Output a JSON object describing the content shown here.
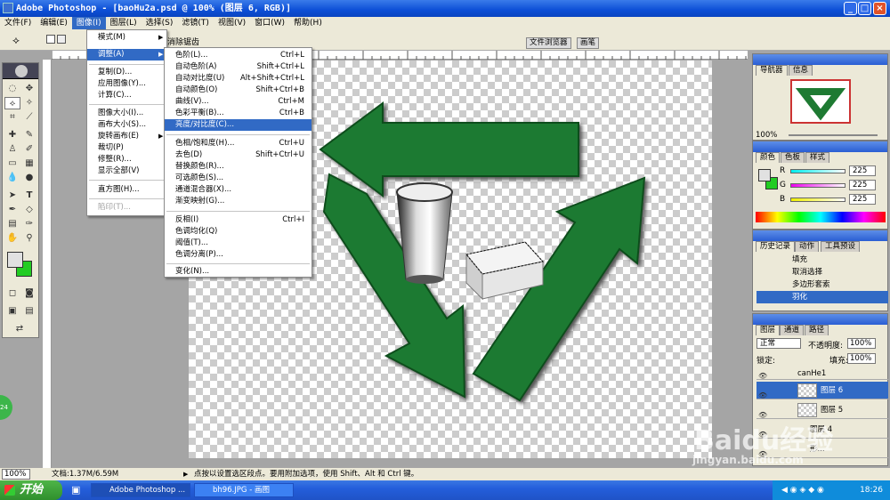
{
  "window": {
    "title": "Adobe Photoshop - [baoHu2a.psd @ 100% (图层 6, RGB)]"
  },
  "menubar": {
    "items": [
      "文件(F)",
      "编辑(E)",
      "图像(I)",
      "图层(L)",
      "选择(S)",
      "滤镜(T)",
      "视图(V)",
      "窗口(W)",
      "帮助(H)"
    ]
  },
  "optionbar": {
    "clear_label": "消除锯齿"
  },
  "tabs": {
    "file_browser": "文件浏览器",
    "brushes": "画笔"
  },
  "image_menu": {
    "items": [
      "模式(M)",
      "调整(A)",
      "复制(D)...",
      "应用图像(Y)...",
      "计算(C)...",
      "图像大小(I)...",
      "画布大小(S)...",
      "旋转画布(E)",
      "裁切(P)",
      "修整(R)...",
      "显示全部(V)",
      "直方图(H)...",
      "陷印(T)..."
    ],
    "highlighted": "调整(A)",
    "disabled": "陷印(T)..."
  },
  "adjust_menu": {
    "items": [
      {
        "label": "色阶(L)...",
        "shortcut": "Ctrl+L"
      },
      {
        "label": "自动色阶(A)",
        "shortcut": "Shift+Ctrl+L"
      },
      {
        "label": "自动对比度(U)",
        "shortcut": "Alt+Shift+Ctrl+L"
      },
      {
        "label": "自动颜色(O)",
        "shortcut": "Shift+Ctrl+B"
      },
      {
        "label": "曲线(V)...",
        "shortcut": "Ctrl+M"
      },
      {
        "label": "色彩平衡(B)...",
        "shortcut": "Ctrl+B"
      },
      {
        "label": "亮度/对比度(C)...",
        "shortcut": ""
      },
      {
        "label": "色相/饱和度(H)...",
        "shortcut": "Ctrl+U"
      },
      {
        "label": "去色(D)",
        "shortcut": "Shift+Ctrl+U"
      },
      {
        "label": "替换颜色(R)...",
        "shortcut": ""
      },
      {
        "label": "可选颜色(S)...",
        "shortcut": ""
      },
      {
        "label": "通道混合器(X)...",
        "shortcut": ""
      },
      {
        "label": "渐变映射(G)...",
        "shortcut": ""
      },
      {
        "label": "反相(I)",
        "shortcut": "Ctrl+I"
      },
      {
        "label": "色调均化(Q)",
        "shortcut": ""
      },
      {
        "label": "阈值(T)...",
        "shortcut": ""
      },
      {
        "label": "色调分离(P)...",
        "shortcut": ""
      },
      {
        "label": "变化(N)...",
        "shortcut": ""
      }
    ],
    "highlighted": "亮度/对比度(C)..."
  },
  "navigator": {
    "tabs": [
      "导航器",
      "信息"
    ],
    "zoom": "100%"
  },
  "color": {
    "tabs": [
      "颜色",
      "色板",
      "样式"
    ],
    "channels": [
      {
        "name": "R",
        "value": "225"
      },
      {
        "name": "G",
        "value": "225"
      },
      {
        "name": "B",
        "value": "225"
      }
    ]
  },
  "history": {
    "tabs": [
      "历史记录",
      "动作",
      "工具预设"
    ],
    "items": [
      "填充",
      "取消选择",
      "多边形套索",
      "羽化"
    ],
    "selected": "羽化"
  },
  "layers": {
    "tabs": [
      "图层",
      "通道",
      "路径"
    ],
    "blend_mode": "正常",
    "opacity_label": "不透明度:",
    "opacity": "100%",
    "lock_label": "锁定:",
    "fill_label": "填充:",
    "fill": "100%",
    "group": "canHe1",
    "items": [
      "图层 6",
      "图层 5",
      "图层 4",
      "形..."
    ],
    "selected": "图层 6"
  },
  "status": {
    "zoom": "100%",
    "doc_size": "文档:1.37M/6.59M",
    "hint": "点按以设置选区段点。要用附加选项，使用 Shift、Alt 和 Ctrl 键。"
  },
  "taskbar": {
    "start": "开始",
    "tasks": [
      "Adobe Photoshop ...",
      "bh96.JPG - 画图"
    ],
    "time": "18:26"
  },
  "watermark": {
    "brand": "Baidu经验",
    "url": "jingyan.baidu.com"
  },
  "colors": {
    "green": "#1e7a32",
    "highlight": "#316ac5",
    "titlebar": "#0d4fd6",
    "fg_swatch": "#e1e1e1",
    "bg_swatch": "#22cc22"
  }
}
